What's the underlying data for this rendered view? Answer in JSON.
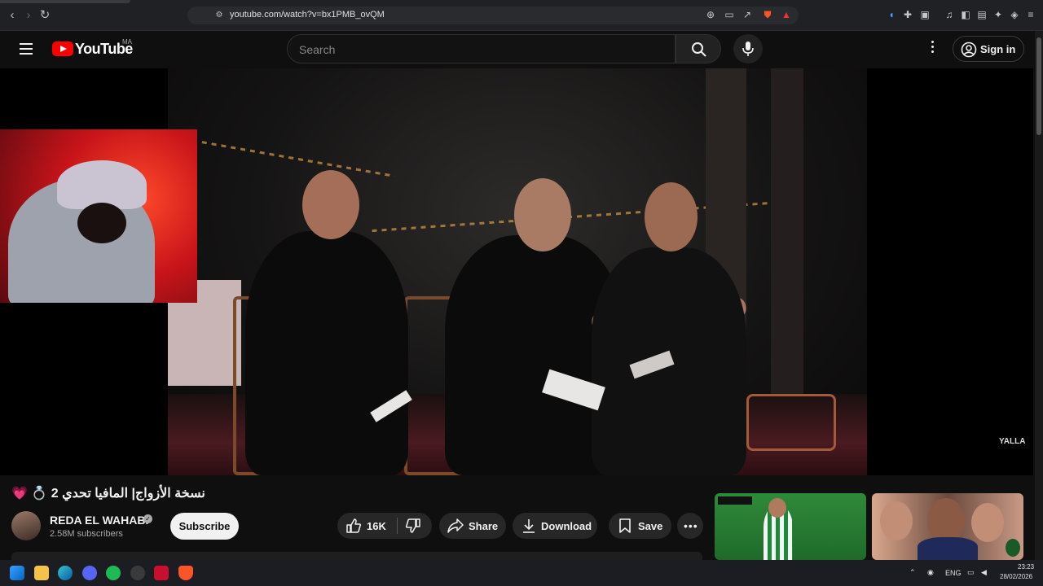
{
  "browser": {
    "url": "youtube.com/watch?v=bx1PMB_ovQM"
  },
  "header": {
    "logo_text": "YouTube",
    "country_code": "MA",
    "search_placeholder": "Search",
    "sign_in_label": "Sign in"
  },
  "video": {
    "watermark": "YALLA",
    "title": "💗 💍 2 نسخة الأزواج| المافيا تحدي"
  },
  "channel": {
    "name": "REDA EL WAHABI",
    "subscribers": "2.58M subscribers",
    "subscribe_label": "Subscribe"
  },
  "actions": {
    "likes": "16K",
    "share_label": "Share",
    "download_label": "Download",
    "save_label": "Save"
  },
  "taskbar": {
    "language": "ENG",
    "time": "23:23",
    "date": "28/02/2026"
  },
  "colors": {
    "background": "#0f0f0f",
    "brand_red": "#ff0000",
    "pill": "#272727"
  }
}
